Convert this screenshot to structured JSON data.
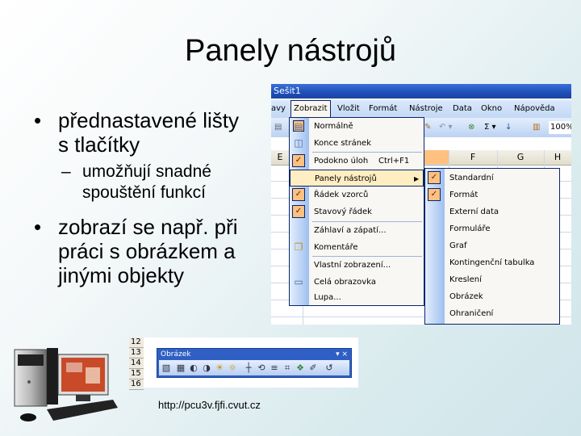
{
  "slide": {
    "title": "Panely nástrojů",
    "bullets": [
      {
        "text_line1": "přednastavené lišty",
        "text_line2": "s tlačítky",
        "sub": {
          "line1": "umožňují snadné",
          "line2": "spouštění funkcí"
        }
      },
      {
        "text_line1": "zobrazí se např. při",
        "text_line2": "práci s obrázkem a",
        "text_line3": "jinými objekty"
      }
    ],
    "bullet_glyph": "•",
    "dash_glyph": "–",
    "footer_url": "http://pcu3v.fjfi.cvut.cz"
  },
  "excel": {
    "window_title": "Sešit1",
    "menubar": [
      "avy",
      "Zobrazit",
      "Vložit",
      "Formát",
      "Nástroje",
      "Data",
      "Okno",
      "Nápověda"
    ],
    "toolbar_zoom": "100%",
    "toolbar_icons": [
      "brush-icon",
      "undo-icon",
      "hyperlink-icon",
      "autosum-icon",
      "sort-ascending-icon",
      "chart-wizard-icon"
    ],
    "column_headers": [
      "E",
      "F",
      "G",
      "H"
    ],
    "view_menu": {
      "items": [
        {
          "label": "Normálně",
          "icon": "normal-view-icon",
          "selected": true
        },
        {
          "label": "Konce stránek",
          "icon": "page-break-icon"
        },
        {
          "label": "Podokno úloh",
          "shortcut": "Ctrl+F1",
          "checked": true
        },
        {
          "label": "Panely nástrojů",
          "submenu": true,
          "highlighted": true
        },
        {
          "label": "Řádek vzorců",
          "checked": true
        },
        {
          "label": "Stavový řádek",
          "checked": true
        },
        {
          "label": "Záhlaví a zápatí..."
        },
        {
          "label": "Komentáře",
          "icon": "comments-icon"
        },
        {
          "label": "Vlastní zobrazení..."
        },
        {
          "label": "Celá obrazovka",
          "icon": "full-screen-icon"
        },
        {
          "label": "Lupa..."
        }
      ]
    },
    "toolbars_submenu": {
      "items": [
        {
          "label": "Standardní",
          "checked": true
        },
        {
          "label": "Formát",
          "checked": true
        },
        {
          "label": "Externí data"
        },
        {
          "label": "Formuláře"
        },
        {
          "label": "Graf"
        },
        {
          "label": "Kontingenční tabulka"
        },
        {
          "label": "Kreslení"
        },
        {
          "label": "Obrázek"
        },
        {
          "label": "Ohraničení"
        }
      ]
    },
    "check_glyph": "✓",
    "arrow_glyph": "▶"
  },
  "picture_toolbar": {
    "row_numbers": [
      "12",
      "13",
      "14",
      "15",
      "16"
    ],
    "title": "Obrázek",
    "controls": "▾ ×",
    "buttons": [
      "insert-picture",
      "color",
      "more-contrast",
      "less-contrast",
      "more-brightness",
      "less-brightness",
      "crop",
      "rotate-left",
      "line-style",
      "compress-pictures",
      "recolor",
      "format-picture",
      "set-transparent-color",
      "reset-picture"
    ]
  }
}
